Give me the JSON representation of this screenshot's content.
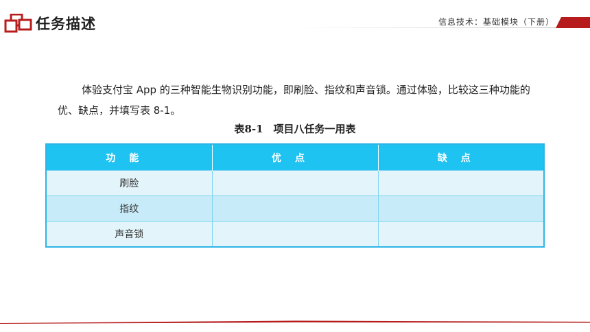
{
  "header": {
    "section_title": "任务描述",
    "course_title": "信息技术：基础模块（下册）"
  },
  "body": {
    "paragraph": "体验支付宝 App 的三种智能生物识别功能，即刷脸、指纹和声音锁。通过体验，比较这三种功能的优、缺点，并填写表 8-1。"
  },
  "table": {
    "caption": "表8-1　项目八任务一用表",
    "headers": [
      "功能",
      "优点",
      "缺点"
    ],
    "rows": [
      [
        "刷脸",
        "",
        ""
      ],
      [
        "指纹",
        "",
        ""
      ],
      [
        "声音锁",
        "",
        ""
      ]
    ]
  },
  "colors": {
    "accent_red": "#b71c1c",
    "table_header": "#1ec3f1",
    "row_light": "#e3f5fb",
    "row_dark": "#c7ebf8"
  }
}
